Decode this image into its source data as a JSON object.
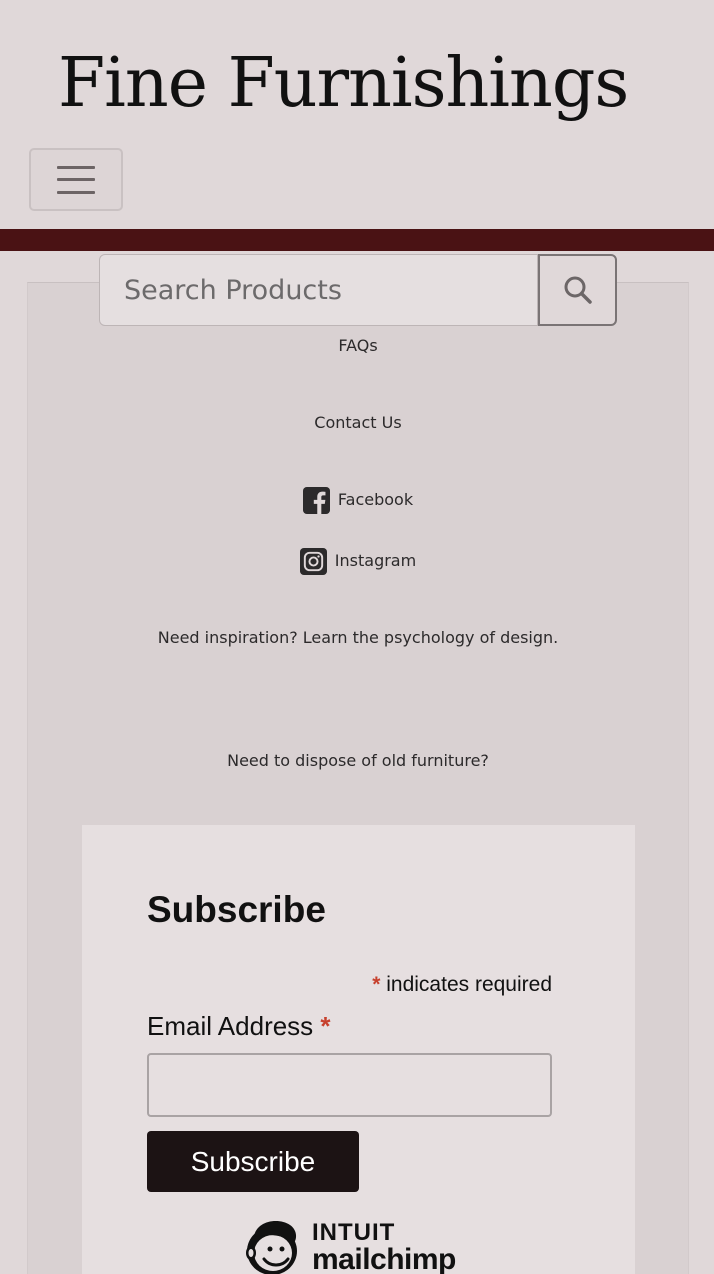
{
  "header": {
    "site_title": "Fine Furnishings",
    "menu_icon": "hamburger-icon"
  },
  "colors": {
    "background": "#e0d8d9",
    "brand_bar": "#4a1214",
    "panel": "#d9d1d2",
    "subscribe_button": "#1c1314",
    "required_asterisk": "#c7402d"
  },
  "search": {
    "placeholder": "Search Products",
    "value": "",
    "button_icon": "search-icon"
  },
  "links": {
    "faqs": "FAQs",
    "contact": "Contact Us",
    "facebook": "Facebook",
    "facebook_icon": "facebook-icon",
    "instagram": "Instagram",
    "instagram_icon": "instagram-icon",
    "inspiration": "Need inspiration? Learn the psychology of design.",
    "dispose": "Need to dispose of old furniture?"
  },
  "subscribe": {
    "heading": "Subscribe",
    "required_asterisk": "*",
    "required_note": "indicates required",
    "email_label": "Email Address",
    "email_required_marker": "*",
    "email_value": "",
    "button_label": "Subscribe",
    "logo_line1": "INTUIT",
    "logo_line2": "mailchimp"
  }
}
